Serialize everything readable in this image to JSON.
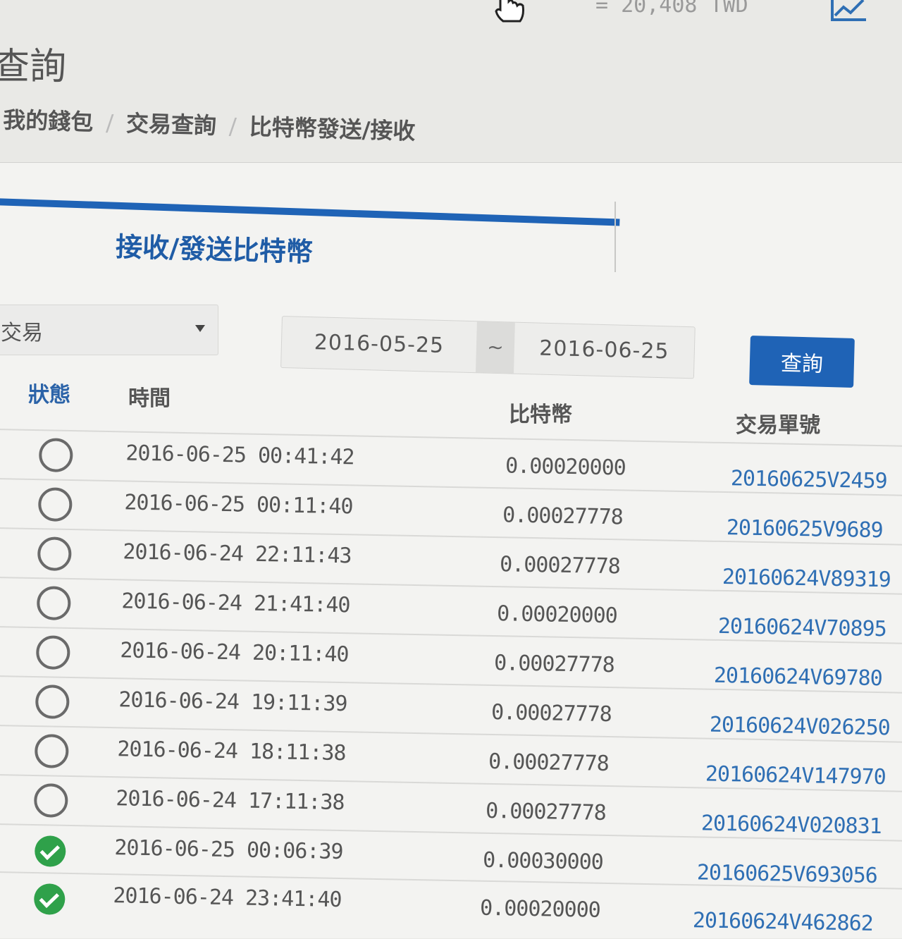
{
  "header": {
    "balance": "= 20,408 TWD",
    "chart_icon": "line-chart-icon",
    "cursor_icon": "hand-pointer-icon"
  },
  "page": {
    "title": "查詢"
  },
  "breadcrumb": {
    "items": [
      "我的錢包",
      "交易查詢",
      "比特幣發送/接收"
    ],
    "separator": "/"
  },
  "panel": {
    "tab_title": "接收/發送比特幣",
    "accent_color": "#1f63b6"
  },
  "filters": {
    "type_select": "交易",
    "date_from": "2016-05-25",
    "date_separator": "~",
    "date_to": "2016-06-25",
    "query_label": "查詢"
  },
  "table": {
    "headers": {
      "status": "狀態",
      "time": "時間",
      "btc": "比特幣",
      "txid": "交易單號"
    },
    "rows": [
      {
        "status": "pending",
        "time": "2016-06-25 00:41:42",
        "btc": "0.00020000",
        "txid": "20160625V2459"
      },
      {
        "status": "pending",
        "time": "2016-06-25 00:11:40",
        "btc": "0.00027778",
        "txid": "20160625V9689"
      },
      {
        "status": "pending",
        "time": "2016-06-24 22:11:43",
        "btc": "0.00027778",
        "txid": "20160624V89319"
      },
      {
        "status": "pending",
        "time": "2016-06-24 21:41:40",
        "btc": "0.00020000",
        "txid": "20160624V70895"
      },
      {
        "status": "pending",
        "time": "2016-06-24 20:11:40",
        "btc": "0.00027778",
        "txid": "20160624V69780"
      },
      {
        "status": "pending",
        "time": "2016-06-24 19:11:39",
        "btc": "0.00027778",
        "txid": "20160624V026250"
      },
      {
        "status": "pending",
        "time": "2016-06-24 18:11:38",
        "btc": "0.00027778",
        "txid": "20160624V147970"
      },
      {
        "status": "pending",
        "time": "2016-06-24 17:11:38",
        "btc": "0.00027778",
        "txid": "20160624V020831"
      },
      {
        "status": "completed",
        "time": "2016-06-25 00:06:39",
        "btc": "0.00030000",
        "txid": "20160625V693056"
      },
      {
        "status": "completed",
        "time": "2016-06-24 23:41:40",
        "btc": "0.00020000",
        "txid": "20160624V462862"
      }
    ],
    "status_colors": {
      "pending": "#6a6a6a",
      "completed": "#2fa14a"
    }
  }
}
